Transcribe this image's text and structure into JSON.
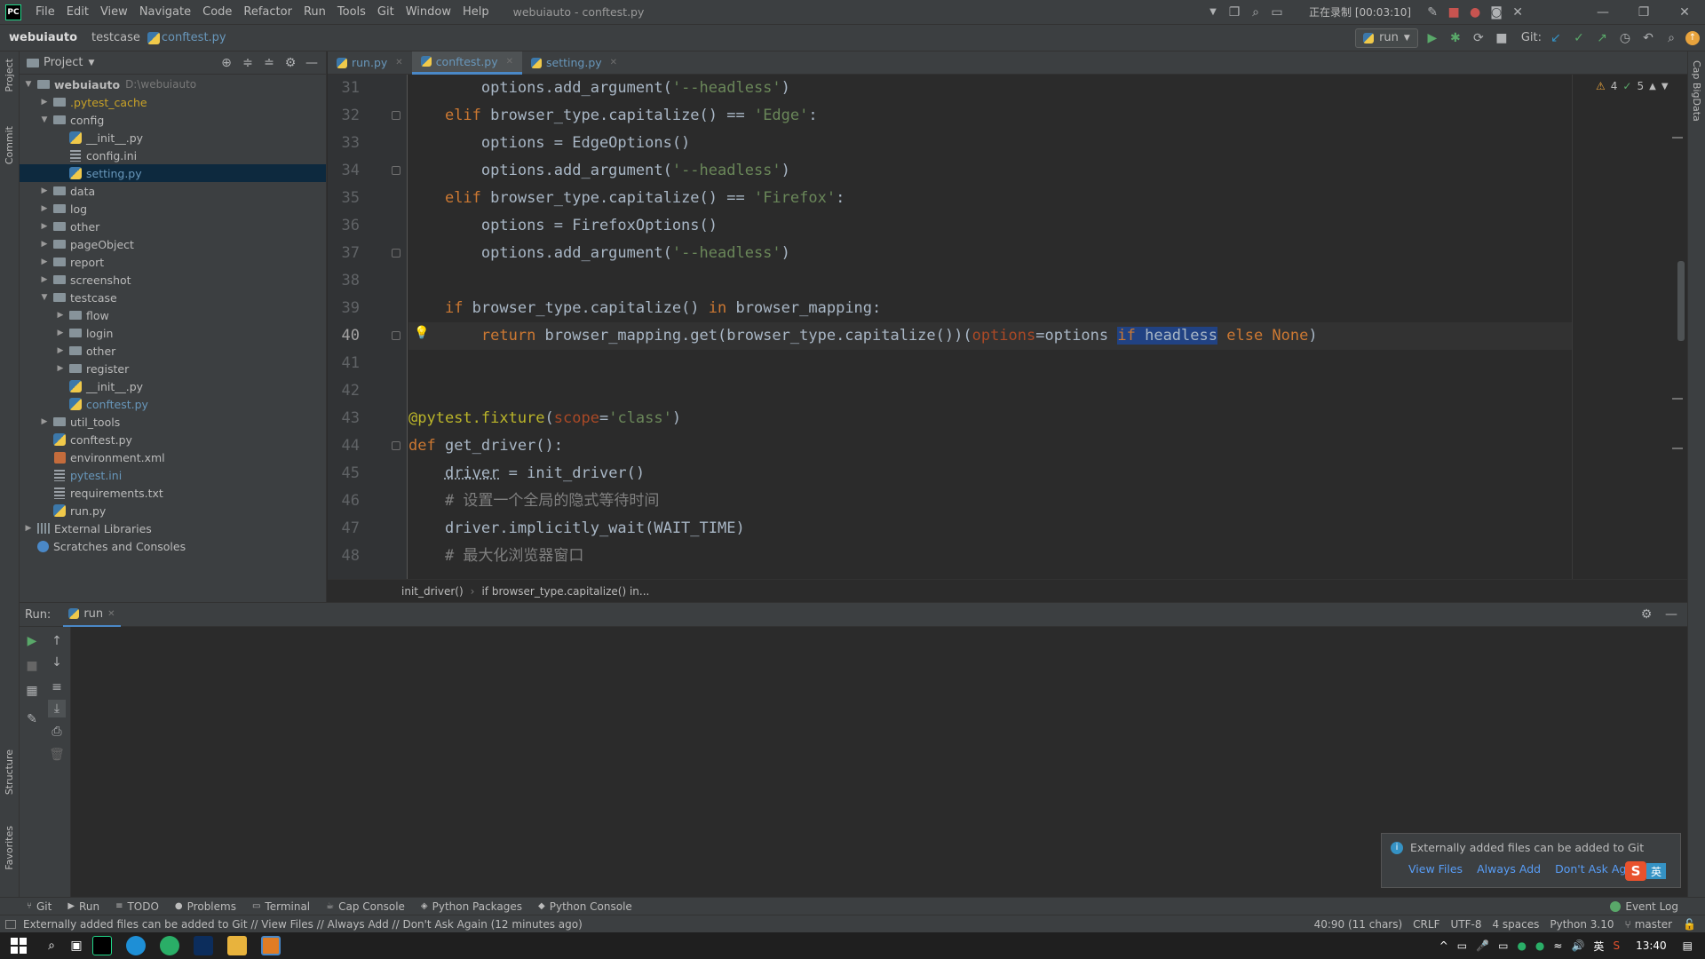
{
  "titlebar": {
    "menus": [
      "File",
      "Edit",
      "View",
      "Navigate",
      "Code",
      "Refactor",
      "Run",
      "Tools",
      "Git",
      "Window",
      "Help"
    ],
    "title": "webuiauto - conftest.py",
    "recording": "正在录制 [00:03:10]",
    "app_logo": "PC"
  },
  "navbar": {
    "crumbs": [
      "webuiauto",
      "testcase",
      "conftest.py"
    ],
    "run_config": "run",
    "git_label": "Git:"
  },
  "left_stripe": {
    "project": "Project",
    "commit": "Commit",
    "structure": "Structure",
    "favorites": "Favorites"
  },
  "right_stripe": {
    "label": "Cap BigData"
  },
  "project_panel": {
    "title": "Project",
    "tree": [
      {
        "label": "webuiauto",
        "extra": "D:\\webuiauto",
        "depth": 0,
        "type": "folder",
        "expanded": true,
        "color": "#bbbbbb",
        "bold": true
      },
      {
        "label": ".pytest_cache",
        "depth": 1,
        "type": "folder",
        "expanded": false,
        "color": "#c9a227"
      },
      {
        "label": "config",
        "depth": 1,
        "type": "folder",
        "expanded": true,
        "color": "#bbbbbb"
      },
      {
        "label": "__init__.py",
        "depth": 2,
        "type": "py",
        "color": "#bbbbbb"
      },
      {
        "label": "config.ini",
        "depth": 2,
        "type": "txt",
        "color": "#bbbbbb"
      },
      {
        "label": "setting.py",
        "depth": 2,
        "type": "py",
        "color": "#6897bb",
        "selected": true
      },
      {
        "label": "data",
        "depth": 1,
        "type": "folder",
        "expanded": false,
        "color": "#bbbbbb"
      },
      {
        "label": "log",
        "depth": 1,
        "type": "folder",
        "expanded": false,
        "color": "#bbbbbb"
      },
      {
        "label": "other",
        "depth": 1,
        "type": "folder",
        "expanded": false,
        "color": "#bbbbbb"
      },
      {
        "label": "pageObject",
        "depth": 1,
        "type": "folder",
        "expanded": false,
        "color": "#bbbbbb"
      },
      {
        "label": "report",
        "depth": 1,
        "type": "folder",
        "expanded": false,
        "color": "#bbbbbb"
      },
      {
        "label": "screenshot",
        "depth": 1,
        "type": "folder",
        "expanded": false,
        "color": "#bbbbbb"
      },
      {
        "label": "testcase",
        "depth": 1,
        "type": "folder",
        "expanded": true,
        "color": "#bbbbbb"
      },
      {
        "label": "flow",
        "depth": 2,
        "type": "folder",
        "expanded": false,
        "color": "#bbbbbb"
      },
      {
        "label": "login",
        "depth": 2,
        "type": "folder",
        "expanded": false,
        "color": "#bbbbbb"
      },
      {
        "label": "other",
        "depth": 2,
        "type": "folder",
        "expanded": false,
        "color": "#bbbbbb"
      },
      {
        "label": "register",
        "depth": 2,
        "type": "folder",
        "expanded": false,
        "color": "#bbbbbb"
      },
      {
        "label": "__init__.py",
        "depth": 2,
        "type": "py",
        "color": "#bbbbbb"
      },
      {
        "label": "conftest.py",
        "depth": 2,
        "type": "py",
        "color": "#6897bb"
      },
      {
        "label": "util_tools",
        "depth": 1,
        "type": "folder",
        "expanded": false,
        "color": "#bbbbbb"
      },
      {
        "label": "conftest.py",
        "depth": 1,
        "type": "py",
        "color": "#bbbbbb"
      },
      {
        "label": "environment.xml",
        "depth": 1,
        "type": "xml",
        "color": "#bbbbbb"
      },
      {
        "label": "pytest.ini",
        "depth": 1,
        "type": "txt",
        "color": "#6897bb"
      },
      {
        "label": "requirements.txt",
        "depth": 1,
        "type": "txt",
        "color": "#bbbbbb"
      },
      {
        "label": "run.py",
        "depth": 1,
        "type": "py",
        "color": "#bbbbbb"
      },
      {
        "label": "External Libraries",
        "depth": 0,
        "type": "lib",
        "expanded": false,
        "color": "#bbbbbb"
      },
      {
        "label": "Scratches and Consoles",
        "depth": 0,
        "type": "scratch",
        "color": "#bbbbbb"
      }
    ]
  },
  "editor": {
    "tabs": [
      {
        "label": "run.py",
        "active": false
      },
      {
        "label": "conftest.py",
        "active": true
      },
      {
        "label": "setting.py",
        "active": false
      }
    ],
    "inspections": {
      "warnings": "4",
      "ok": "5"
    },
    "lines": [
      {
        "num": "31",
        "indent": "        ",
        "segs": [
          [
            "",
            "options.add_argument("
          ],
          [
            "st",
            "'--headless'"
          ],
          [
            "",
            ")"
          ]
        ]
      },
      {
        "num": "32",
        "indent": "    ",
        "segs": [
          [
            "kw",
            "elif "
          ],
          [
            "",
            "browser_type.capitalize() == "
          ],
          [
            "st",
            "'Edge'"
          ],
          [
            "",
            ":"
          ]
        ]
      },
      {
        "num": "33",
        "indent": "        ",
        "segs": [
          [
            "",
            "options = EdgeOptions()"
          ]
        ]
      },
      {
        "num": "34",
        "indent": "        ",
        "segs": [
          [
            "",
            "options.add_argument("
          ],
          [
            "st",
            "'--headless'"
          ],
          [
            "",
            ")"
          ]
        ]
      },
      {
        "num": "35",
        "indent": "    ",
        "segs": [
          [
            "kw",
            "elif "
          ],
          [
            "",
            "browser_type.capitalize() == "
          ],
          [
            "st",
            "'Firefox'"
          ],
          [
            "",
            ":"
          ]
        ]
      },
      {
        "num": "36",
        "indent": "        ",
        "segs": [
          [
            "",
            "options = FirefoxOptions()"
          ]
        ]
      },
      {
        "num": "37",
        "indent": "        ",
        "segs": [
          [
            "",
            "options.add_argument("
          ],
          [
            "st",
            "'--headless'"
          ],
          [
            "",
            ")"
          ]
        ]
      },
      {
        "num": "38",
        "indent": "",
        "segs": []
      },
      {
        "num": "39",
        "indent": "    ",
        "segs": [
          [
            "kw",
            "if "
          ],
          [
            "",
            "browser_type.capitalize() "
          ],
          [
            "kw",
            "in "
          ],
          [
            "",
            "browser_mapping:"
          ]
        ]
      },
      {
        "num": "40",
        "indent": "        ",
        "cur": true,
        "segs": [
          [
            "kw",
            "return "
          ],
          [
            "",
            "browser_mapping.get(browser_type.capitalize())("
          ],
          [
            "pm",
            "options"
          ],
          [
            "",
            "=options "
          ],
          [
            "kw hl",
            "if "
          ],
          [
            "hl",
            "headless"
          ],
          [
            "",
            " "
          ],
          [
            "kw",
            "else None"
          ],
          [
            "",
            ")"
          ]
        ]
      },
      {
        "num": "41",
        "indent": "",
        "segs": []
      },
      {
        "num": "42",
        "indent": "",
        "segs": []
      },
      {
        "num": "43",
        "indent": "",
        "segs": [
          [
            "dec",
            "@pytest.fixture"
          ],
          [
            "",
            "("
          ],
          [
            "pm",
            "scope"
          ],
          [
            "",
            "="
          ],
          [
            "st",
            "'class'"
          ],
          [
            "",
            ")"
          ]
        ]
      },
      {
        "num": "44",
        "indent": "",
        "segs": [
          [
            "kw",
            "def "
          ],
          [
            "",
            "get_driver():"
          ]
        ]
      },
      {
        "num": "45",
        "indent": "    ",
        "segs": [
          [
            "ul",
            "driver"
          ],
          [
            "",
            " = init_driver()"
          ]
        ]
      },
      {
        "num": "46",
        "indent": "    ",
        "segs": [
          [
            "cm",
            "# 设置一个全局的隐式等待时间"
          ]
        ]
      },
      {
        "num": "47",
        "indent": "    ",
        "segs": [
          [
            "",
            "driver.implicitly_wait(WAIT_TIME)"
          ]
        ]
      },
      {
        "num": "48",
        "indent": "    ",
        "segs": [
          [
            "cm",
            "# 最大化浏览器窗口"
          ]
        ]
      }
    ],
    "breadcrumb": [
      "init_driver()",
      "if browser_type.capitalize() in..."
    ]
  },
  "run_panel": {
    "label": "Run:",
    "tab": "run"
  },
  "tool_windows": [
    "Git",
    "Run",
    "TODO",
    "Problems",
    "Terminal",
    "Cap Console",
    "Python Packages",
    "Python Console"
  ],
  "event_log": "Event Log",
  "notification": {
    "message": "Externally added files can be added to Git",
    "actions": [
      "View Files",
      "Always Add",
      "Don't Ask Again"
    ]
  },
  "statusbar": {
    "message": "Externally added files can be added to Git // View Files // Always Add // Don't Ask Again (12 minutes ago)",
    "position": "40:90 (11 chars)",
    "line_sep": "CRLF",
    "encoding": "UTF-8",
    "indent": "4 spaces",
    "interpreter": "Python 3.10",
    "branch": "master"
  },
  "taskbar": {
    "time": "13:40",
    "ime": "英",
    "ime_badge": "英"
  },
  "colors": {
    "accent": "#4a88c7",
    "selection": "#0d293e",
    "highlight": "#214283"
  }
}
